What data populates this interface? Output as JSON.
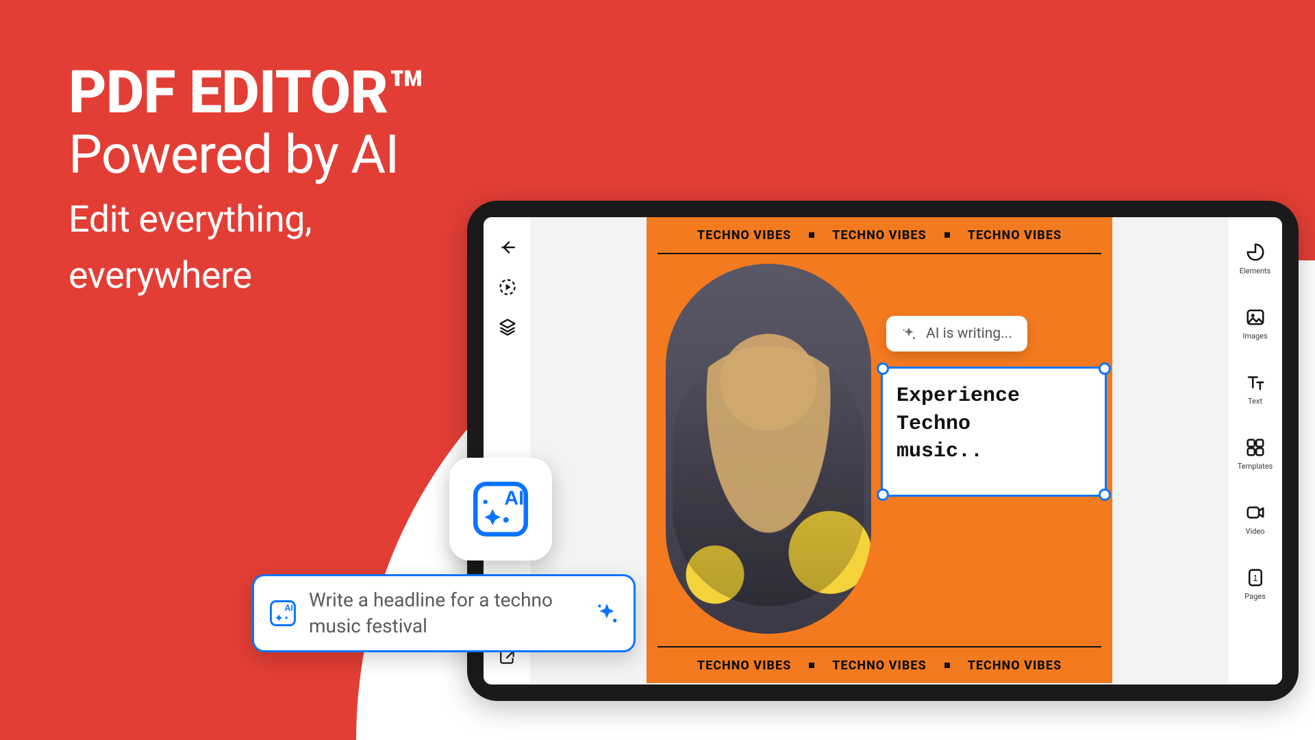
{
  "hero": {
    "title": "PDF EDITOR™",
    "subtitle": "Powered by AI",
    "tagline1": "Edit everything,",
    "tagline2": "everywhere"
  },
  "left_tools": {
    "back": "back-icon",
    "play": "play-icon",
    "layers": "layers-icon",
    "export": "export-icon"
  },
  "right_tools": [
    {
      "name": "elements",
      "label": "Elements"
    },
    {
      "name": "images",
      "label": "Images"
    },
    {
      "name": "text",
      "label": "Text"
    },
    {
      "name": "templates",
      "label": "Templates"
    },
    {
      "name": "video",
      "label": "Video"
    },
    {
      "name": "pages",
      "label": "Pages"
    }
  ],
  "poster": {
    "marquee_item": "TECHNO VIBES",
    "ai_status": "AI is writing...",
    "generated_text": "Experience\nTechno\nmusic.."
  },
  "ai_prompt": {
    "text": "Write a headline for a techno music festival"
  },
  "ai_badge_label": "AI"
}
